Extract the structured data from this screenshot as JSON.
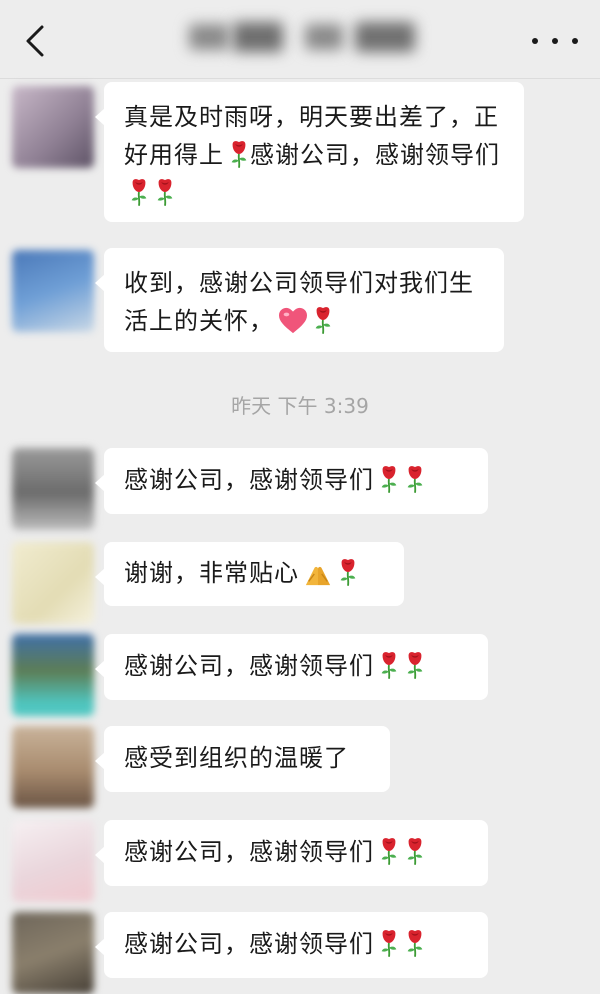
{
  "header": {
    "back_icon": "chevron-left-icon",
    "more_icon": "ellipsis-icon"
  },
  "timestamp": "昨天 下午 3:39",
  "messages": [
    {
      "text": "真是及时雨呀，明天要出差了，正好用得上",
      "after": "感谢公司，感谢领导们",
      "emoji": [
        "rose",
        "rose",
        "rose"
      ]
    },
    {
      "text": "收到，感谢公司领导们对我们生活上的关怀，",
      "emoji": [
        "heart",
        "rose"
      ]
    },
    {
      "text": "感谢公司，感谢领导们",
      "emoji": [
        "rose",
        "rose"
      ]
    },
    {
      "text": "谢谢，非常贴心",
      "emoji": [
        "folded-hands",
        "rose"
      ]
    },
    {
      "text": "感谢公司，感谢领导们",
      "emoji": [
        "rose",
        "rose"
      ]
    },
    {
      "text": "感受到组织的温暖了",
      "emoji": []
    },
    {
      "text": "感谢公司，感谢领导们",
      "emoji": [
        "rose",
        "rose"
      ]
    },
    {
      "text": "感谢公司，感谢领导们",
      "emoji": [
        "rose",
        "rose"
      ]
    }
  ],
  "colors": {
    "background": "#ededed",
    "bubble": "#ffffff",
    "timestamp": "#a5a5a5"
  }
}
